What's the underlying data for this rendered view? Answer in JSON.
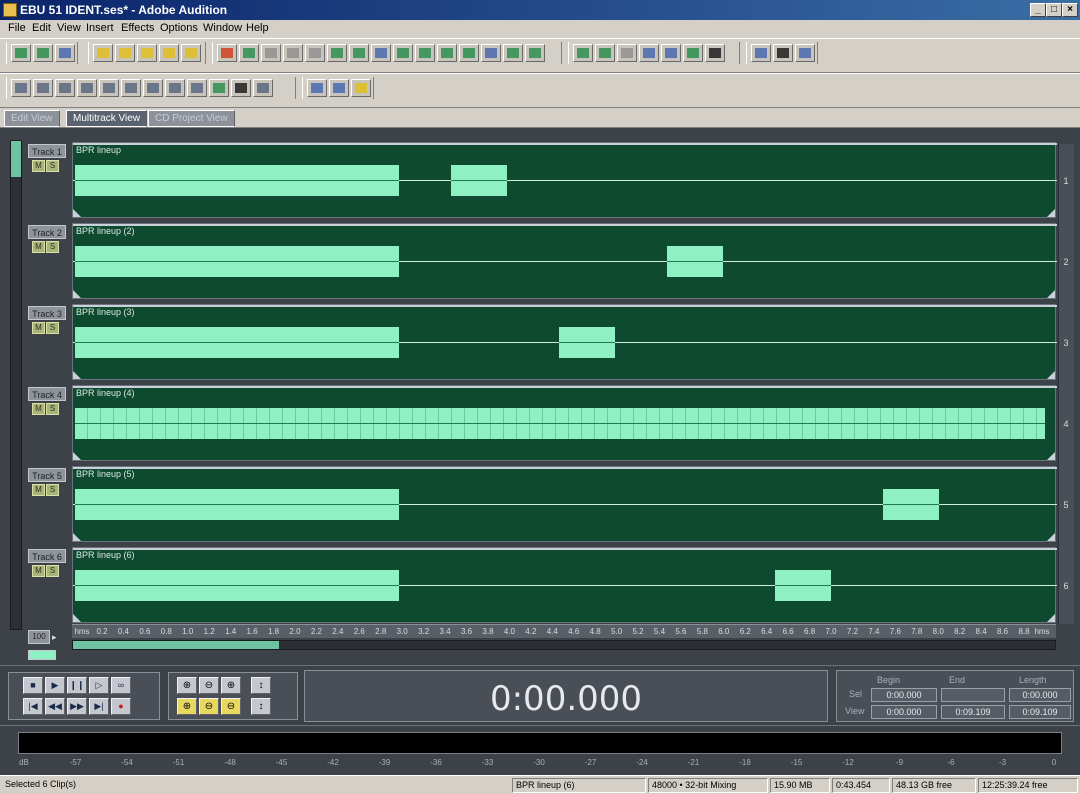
{
  "window": {
    "title": "EBU 51  IDENT.ses* - Adobe Audition",
    "buttons": [
      "_",
      "□",
      "×"
    ]
  },
  "menu": [
    "File",
    "Edit",
    "View",
    "Insert",
    "Effects",
    "Options",
    "Window",
    "Help"
  ],
  "view_tabs": [
    {
      "label": "Edit View",
      "active": false
    },
    {
      "label": "Multitrack View",
      "active": true
    },
    {
      "label": "CD Project View",
      "active": false
    }
  ],
  "tracks": [
    {
      "label": "Track 1",
      "clip": "BPR lineup",
      "num": "1",
      "full": false
    },
    {
      "label": "Track 2",
      "clip": "BPR lineup (2)",
      "num": "2",
      "full": false
    },
    {
      "label": "Track 3",
      "clip": "BPR lineup (3)",
      "num": "3",
      "full": false
    },
    {
      "label": "Track 4",
      "clip": "BPR lineup (4)",
      "num": "4",
      "full": true
    },
    {
      "label": "Track 5",
      "clip": "BPR lineup (5)",
      "num": "5",
      "full": false
    },
    {
      "label": "Track 6",
      "clip": "BPR lineup (6)",
      "num": "6",
      "full": false
    }
  ],
  "track_buttons": {
    "mute": "M",
    "solo": "S"
  },
  "ruler": {
    "start": "hms",
    "end": "hms",
    "ticks": [
      "0.2",
      "0.4",
      "0.6",
      "0.8",
      "1.0",
      "1.2",
      "1.4",
      "1.6",
      "1.8",
      "2.0",
      "2.2",
      "2.4",
      "2.6",
      "2.8",
      "3.0",
      "3.2",
      "3.4",
      "3.6",
      "3.8",
      "4.0",
      "4.2",
      "4.4",
      "4.6",
      "4.8",
      "5.0",
      "5.2",
      "5.4",
      "5.6",
      "5.8",
      "6.0",
      "6.2",
      "6.4",
      "6.6",
      "6.8",
      "7.0",
      "7.2",
      "7.4",
      "7.6",
      "7.8",
      "8.0",
      "8.2",
      "8.4",
      "8.6",
      "8.8"
    ]
  },
  "zoom_box": "100",
  "transport": {
    "row1": [
      "■",
      "▶",
      "❙❙",
      "▷",
      "∞"
    ],
    "row2": [
      "|◀",
      "◀◀",
      "▶▶",
      "▶|",
      "●"
    ]
  },
  "zoom_buttons": {
    "row1": [
      "⊕",
      "⊖",
      "⊕",
      "↕"
    ],
    "row2": [
      "⊕",
      "⊖",
      "⊖",
      "↕"
    ]
  },
  "time": "0:00.000",
  "selection": {
    "headers": [
      "Begin",
      "End",
      "Length"
    ],
    "rows": [
      {
        "label": "Sel",
        "values": [
          "0:00.000",
          "",
          "0:00.000"
        ]
      },
      {
        "label": "View",
        "values": [
          "0:00.000",
          "0:09.109",
          "0:09.109"
        ]
      }
    ]
  },
  "meter_ticks": [
    "dB",
    "-57",
    "-54",
    "-51",
    "-48",
    "-45",
    "-42",
    "-39",
    "-36",
    "-33",
    "-30",
    "-27",
    "-24",
    "-21",
    "-18",
    "-15",
    "-12",
    "-9",
    "-6",
    "-3",
    "0"
  ],
  "status": {
    "left": "Selected 6 Clip(s)",
    "clip": "BPR lineup (6)",
    "format": "48000 • 32-bit Mixing",
    "mem": "15.90 MB",
    "dur": "0:43.454",
    "free": "48.13 GB free",
    "time_free": "12:25:39.24 free"
  },
  "colors": {
    "track_bg": "#0e4a30",
    "clip": "#8ff0c4",
    "titlebar": "#0a246a"
  },
  "icons": [
    "app-icon",
    "toolbar-icons",
    "mute-icon",
    "solo-icon"
  ]
}
